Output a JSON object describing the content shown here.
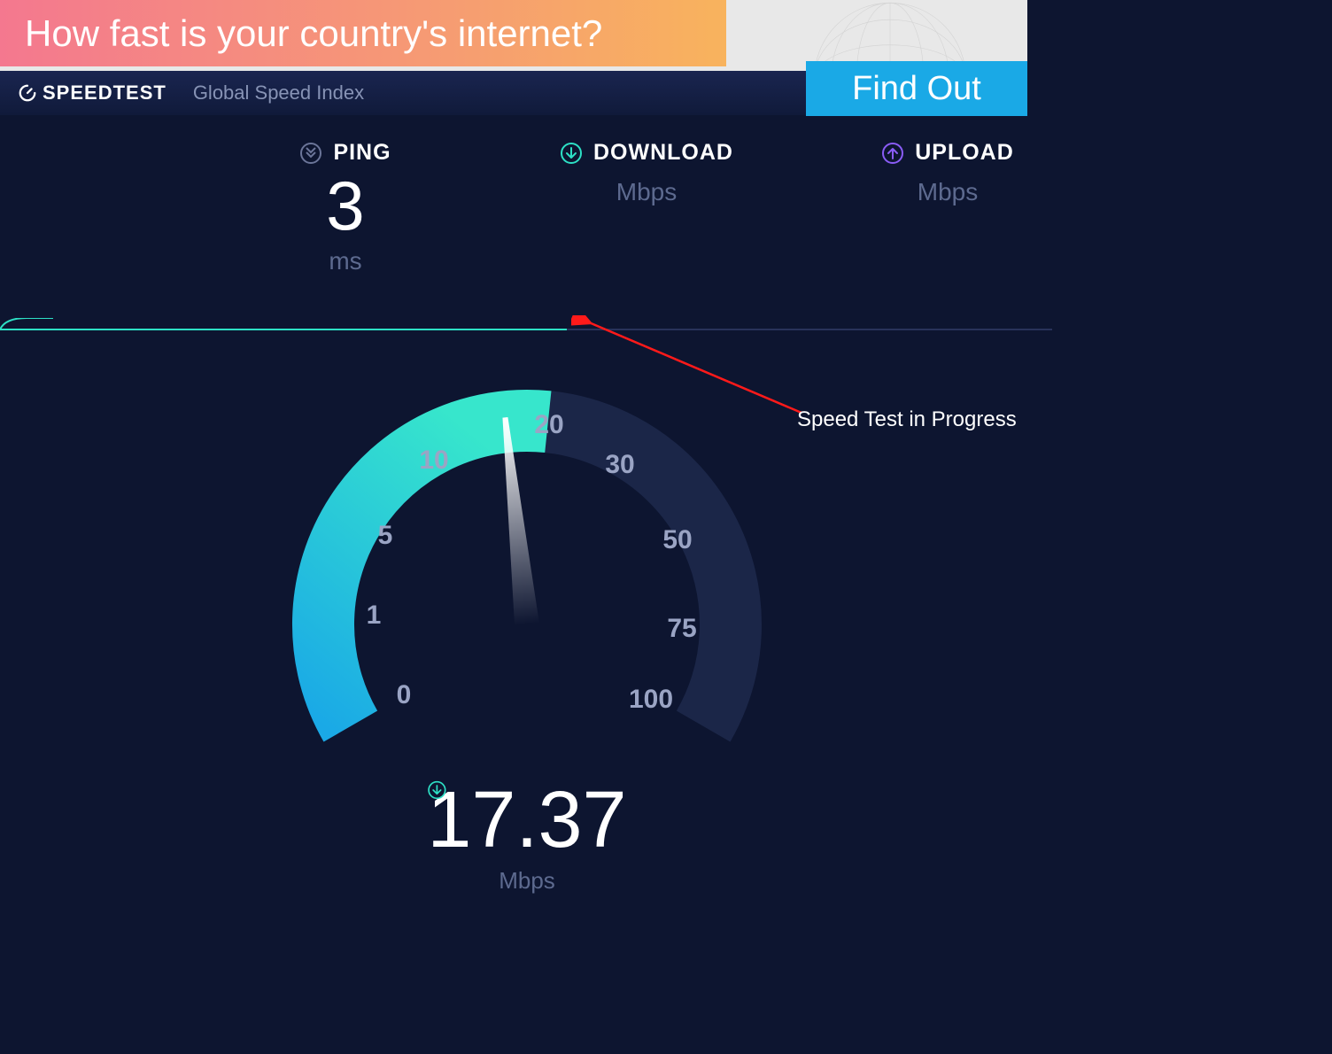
{
  "banner": {
    "headline": "How fast is your country's internet?",
    "brand": "SPEEDTEST",
    "subtitle": "Global Speed Index",
    "cta": "Find Out"
  },
  "metrics": {
    "ping": {
      "label": "PING",
      "value": "3",
      "unit": "ms"
    },
    "download": {
      "label": "DOWNLOAD",
      "value": "",
      "unit": "Mbps"
    },
    "upload": {
      "label": "UPLOAD",
      "value": "",
      "unit": "Mbps"
    }
  },
  "annotation": "Speed Test in Progress",
  "gauge": {
    "ticks": {
      "t0": "0",
      "t1": "1",
      "t5": "5",
      "t10": "10",
      "t20": "20",
      "t30": "30",
      "t50": "50",
      "t75": "75",
      "t100": "100"
    },
    "value": "17.37",
    "unit": "Mbps"
  },
  "colors": {
    "accent_teal": "#2de0c5",
    "accent_blue": "#1aa9e6",
    "accent_purple": "#8a5cf7",
    "gauge_dark": "#1b2648"
  },
  "chart_data": {
    "type": "gauge",
    "title": "Download speed",
    "unit": "Mbps",
    "value": 17.37,
    "ticks": [
      0,
      1,
      5,
      10,
      20,
      30,
      50,
      75,
      100
    ],
    "range": [
      0,
      100
    ],
    "progress_line_percent": 54
  }
}
